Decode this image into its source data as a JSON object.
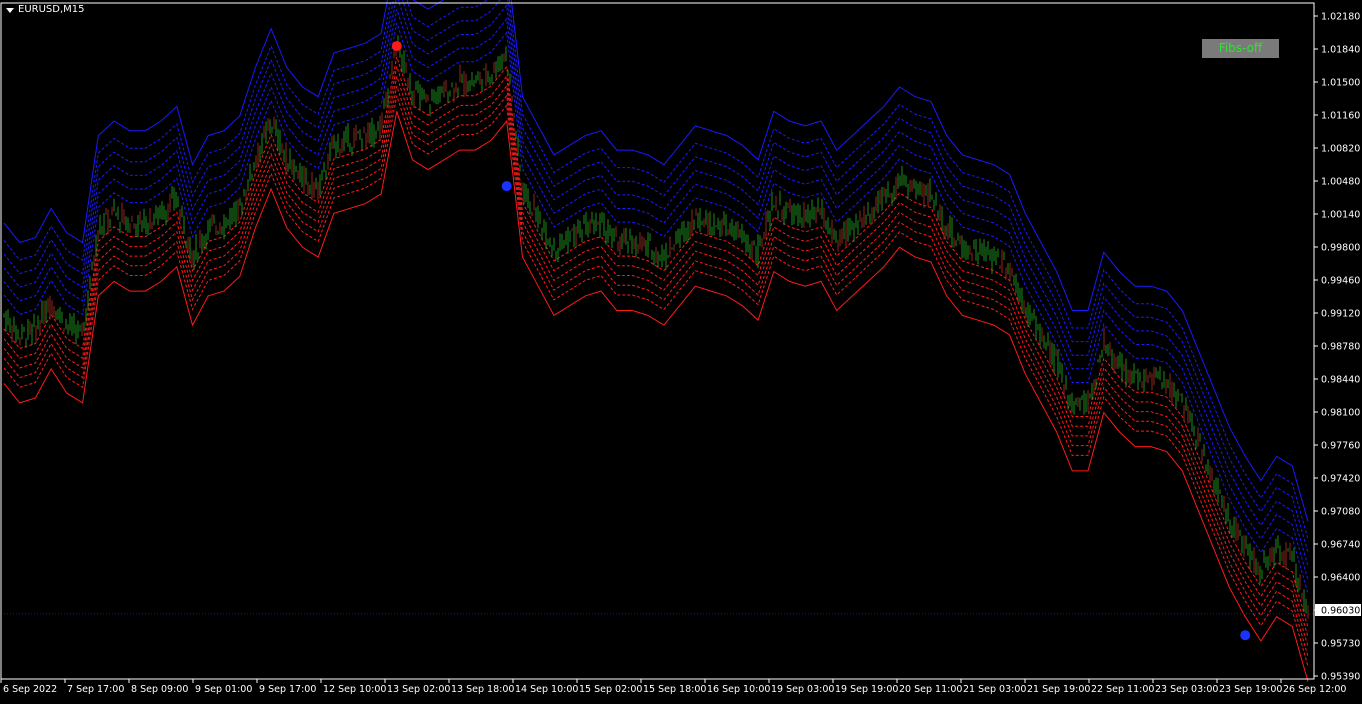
{
  "header": {
    "symbol_label": "EURUSD,M15",
    "dropdown_icon": "triangle-down-icon"
  },
  "toolbar": {
    "fibs_button_label": "Fibs-off"
  },
  "current_price": {
    "label": "0.96030",
    "value": 0.9603
  },
  "colors": {
    "background": "#000000",
    "frame": "#ffffff",
    "upper_band": "#1a1aff",
    "lower_band": "#ff1a1a",
    "candles": "#1e8c1e",
    "candles_alt": "#8c2a1e",
    "buy_marker": "#1a33ff",
    "sell_marker": "#ff1a1a",
    "fibs_text": "#2ce62c",
    "fibs_bg": "#7a7a7a"
  },
  "chart_data": {
    "type": "line",
    "ylim": [
      0.9539,
      1.0226
    ],
    "y_ticks": [
      "1.02180",
      "1.01840",
      "1.01500",
      "1.01160",
      "1.00820",
      "1.00480",
      "1.00140",
      "0.99800",
      "0.99460",
      "0.99120",
      "0.98780",
      "0.98440",
      "0.98100",
      "0.97760",
      "0.97420",
      "0.97080",
      "0.96740",
      "0.96400",
      "0.96030",
      "0.95730",
      "0.95390"
    ],
    "x_tick_labels": [
      "6 Sep 2022",
      "7 Sep 17:00",
      "8 Sep 09:00",
      "9 Sep 01:00",
      "9 Sep 17:00",
      "12 Sep 10:00",
      "13 Sep 02:00",
      "13 Sep 18:00",
      "14 Sep 10:00",
      "15 Sep 02:00",
      "15 Sep 18:00",
      "16 Sep 10:00",
      "19 Sep 03:00",
      "19 Sep 19:00",
      "20 Sep 11:00",
      "21 Sep 03:00",
      "21 Sep 19:00",
      "22 Sep 11:00",
      "23 Sep 03:00",
      "23 Sep 19:00",
      "26 Sep 12:00"
    ],
    "x": [
      0,
      1,
      2,
      3,
      4,
      5,
      6,
      7,
      8,
      9,
      10,
      11,
      12,
      13,
      14,
      15,
      16,
      17,
      18,
      19,
      20,
      21,
      22,
      23,
      24,
      25,
      26,
      27,
      28,
      29,
      30,
      31,
      32,
      33,
      34,
      35,
      36,
      37,
      38,
      39,
      40,
      41,
      42,
      43,
      44,
      45,
      46,
      47,
      48,
      49,
      50,
      51,
      52,
      53,
      54,
      55,
      56,
      57,
      58,
      59,
      60,
      61,
      62,
      63,
      64,
      65,
      66,
      67,
      68,
      69,
      70,
      71,
      72,
      73,
      74,
      75,
      76,
      77,
      78,
      79,
      80,
      81,
      82,
      83
    ],
    "series": [
      {
        "values": [
          0.991,
          0.989,
          0.9895,
          0.9925,
          0.99,
          0.989,
          1.0,
          1.0015,
          1.0005,
          1.0005,
          1.0015,
          1.003,
          0.997,
          1.0,
          1.0005,
          1.002,
          1.007,
          1.011,
          1.007,
          1.005,
          1.004,
          1.0085,
          1.009,
          1.0095,
          1.0105,
          1.019,
          1.014,
          1.013,
          1.014,
          1.015,
          1.015,
          1.016,
          1.018,
          1.004,
          1.001,
          0.998,
          0.999,
          1.0,
          1.0005,
          0.9985,
          0.9985,
          0.998,
          0.997,
          0.999,
          1.001,
          1.0005,
          1.0,
          0.999,
          0.9975,
          1.0025,
          1.0015,
          1.001,
          1.0015,
          0.9985,
          1.0,
          1.0015,
          1.003,
          1.005,
          1.004,
          1.0035,
          1.0,
          0.998,
          0.9975,
          0.997,
          0.996,
          0.992,
          0.989,
          0.986,
          0.982,
          0.982,
          0.988,
          0.986,
          0.9845,
          0.9845,
          0.984,
          0.982,
          0.978,
          0.974,
          0.97,
          0.967,
          0.9645,
          0.967,
          0.966,
          0.9603
        ]
      }
    ],
    "bands": {
      "upper_outer_offset": 0.0095,
      "lower_outer_offset": -0.007,
      "upper_inner_offsets": [
        0.0021,
        0.0035,
        0.0049,
        0.0063,
        0.0077
      ],
      "lower_inner_offsets": [
        -0.0014,
        -0.0024,
        -0.0034,
        -0.0044,
        -0.0054
      ]
    },
    "markers": [
      {
        "type": "sell",
        "x_index": 25,
        "value": 1.0187
      },
      {
        "type": "buy",
        "x_index": 32,
        "value": 1.0043
      },
      {
        "type": "buy",
        "x_index": 79,
        "value": 0.9581
      }
    ],
    "grid": false
  }
}
